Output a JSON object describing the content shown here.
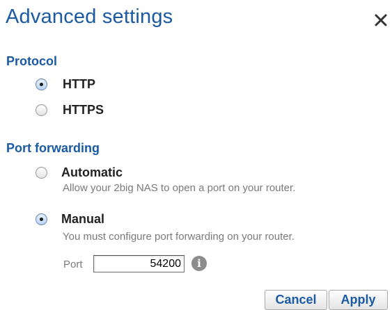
{
  "dialog": {
    "title": "Advanced settings",
    "close_icon": "close-icon"
  },
  "protocol": {
    "heading": "Protocol",
    "options": [
      {
        "label": "HTTP",
        "selected": true
      },
      {
        "label": "HTTPS",
        "selected": false
      }
    ]
  },
  "port_forwarding": {
    "heading": "Port forwarding",
    "options": [
      {
        "label": "Automatic",
        "description": "Allow your 2big NAS to open a port on your router.",
        "selected": false
      },
      {
        "label": "Manual",
        "description": "You must configure port forwarding on your router.",
        "selected": true
      }
    ],
    "port_label": "Port",
    "port_value": "54200",
    "info_icon": "info-icon"
  },
  "buttons": {
    "cancel": "Cancel",
    "apply": "Apply"
  },
  "colors": {
    "accent": "#1b5aa2",
    "description_text": "#7a7a7a",
    "label_text": "#222222"
  }
}
